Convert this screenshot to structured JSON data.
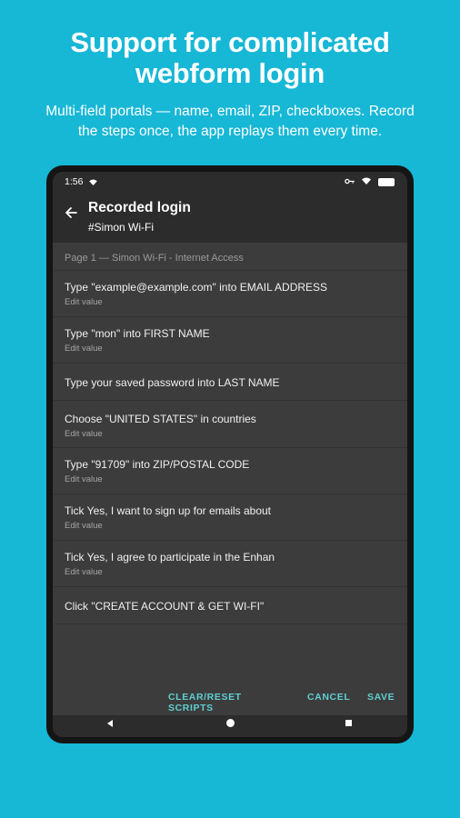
{
  "promo": {
    "headline_line1": "Support for complicated",
    "headline_line2": "webform login",
    "subtitle_line1": "Multi-field portals — name, email, ZIP, checkboxes. Record",
    "subtitle_line2": "the steps once, the app replays them every time."
  },
  "statusbar": {
    "time": "1:56",
    "wifi_icon": "wifi-icon",
    "key_icon": "vpn-key-icon",
    "battery_icon": "battery-icon"
  },
  "appbar": {
    "back_icon": "arrow-back-icon",
    "title": "Recorded login",
    "subtitle": "#Simon Wi-Fi"
  },
  "page_header": "Page 1 — Simon Wi-Fi - Internet Access",
  "steps": [
    {
      "label": "Type \"example@example.com\" into EMAIL ADDRESS",
      "sub": "Edit value"
    },
    {
      "label": "Type \"mon\" into FIRST NAME",
      "sub": "Edit value"
    },
    {
      "label": "Type your saved password into LAST NAME",
      "sub": ""
    },
    {
      "label": "Choose \"UNITED STATES\" in countries",
      "sub": "Edit value"
    },
    {
      "label": "Type \"91709\" into ZIP/POSTAL CODE",
      "sub": "Edit value"
    },
    {
      "label": "Tick Yes, I want to sign up for emails about",
      "sub": "Edit value"
    },
    {
      "label": "Tick Yes, I agree to participate in the Enhan",
      "sub": "Edit value"
    },
    {
      "label": "Click \"CREATE ACCOUNT & GET WI-FI\"",
      "sub": ""
    }
  ],
  "actions": {
    "clear_line1": "CLEAR/RESET",
    "clear_line2": "SCRIPTS",
    "cancel": "CANCEL",
    "save": "SAVE"
  },
  "navbar": {
    "back_icon": "nav-back-icon",
    "home_icon": "nav-home-icon",
    "recents_icon": "nav-recents-icon"
  },
  "colors": {
    "background": "#17b7d6",
    "accent": "#5fcfd1",
    "surface": "#3c3c3c",
    "appbar": "#2c2c2c"
  }
}
